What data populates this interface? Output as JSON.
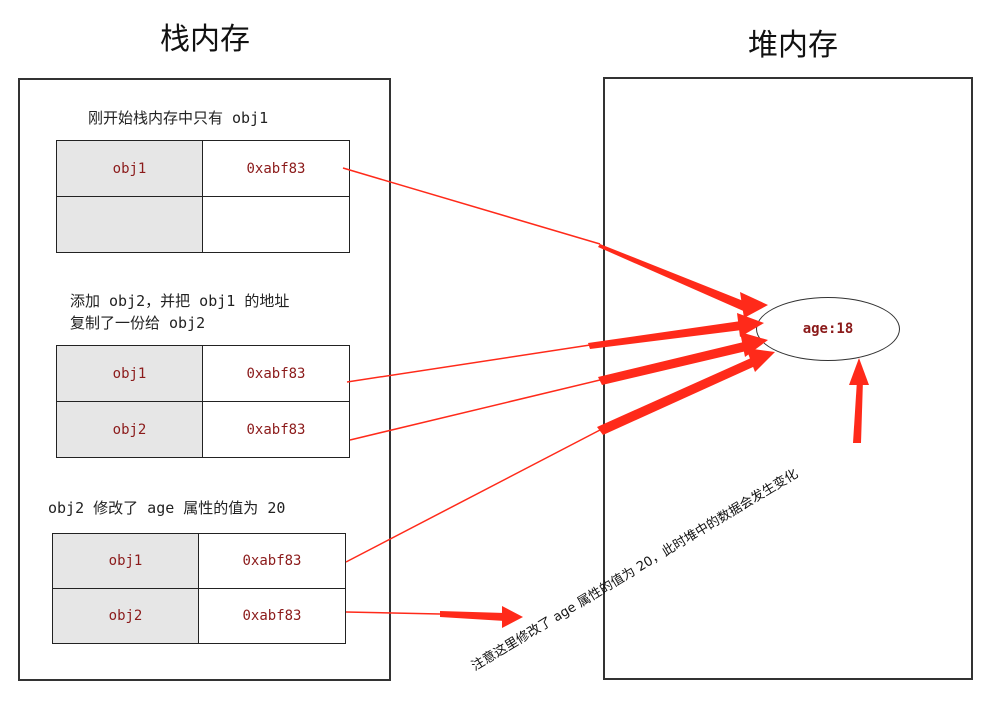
{
  "stack": {
    "title": "栈内存",
    "sections": [
      {
        "caption": "刚开始栈内存中只有 obj1",
        "rows": [
          {
            "name": "obj1",
            "addr": "0xabf83"
          },
          {
            "name": "",
            "addr": ""
          }
        ]
      },
      {
        "caption": "添加 obj2，并把 obj1 的地址\n复制了一份给 obj2",
        "rows": [
          {
            "name": "obj1",
            "addr": "0xabf83"
          },
          {
            "name": "obj2",
            "addr": "0xabf83"
          }
        ]
      },
      {
        "caption": "obj2 修改了 age 属性的值为 20",
        "rows": [
          {
            "name": "obj1",
            "addr": "0xabf83"
          },
          {
            "name": "obj2",
            "addr": "0xabf83"
          }
        ]
      }
    ]
  },
  "heap": {
    "title": "堆内存",
    "object_text": "age:18"
  },
  "note": "注意这里修改了 age 属性的值为 20，此时堆中的数据会发生变化",
  "colors": {
    "arrow": "#ff2a1a",
    "value_text": "#8b1a1a",
    "name_cell_bg": "#e6e6e6"
  }
}
